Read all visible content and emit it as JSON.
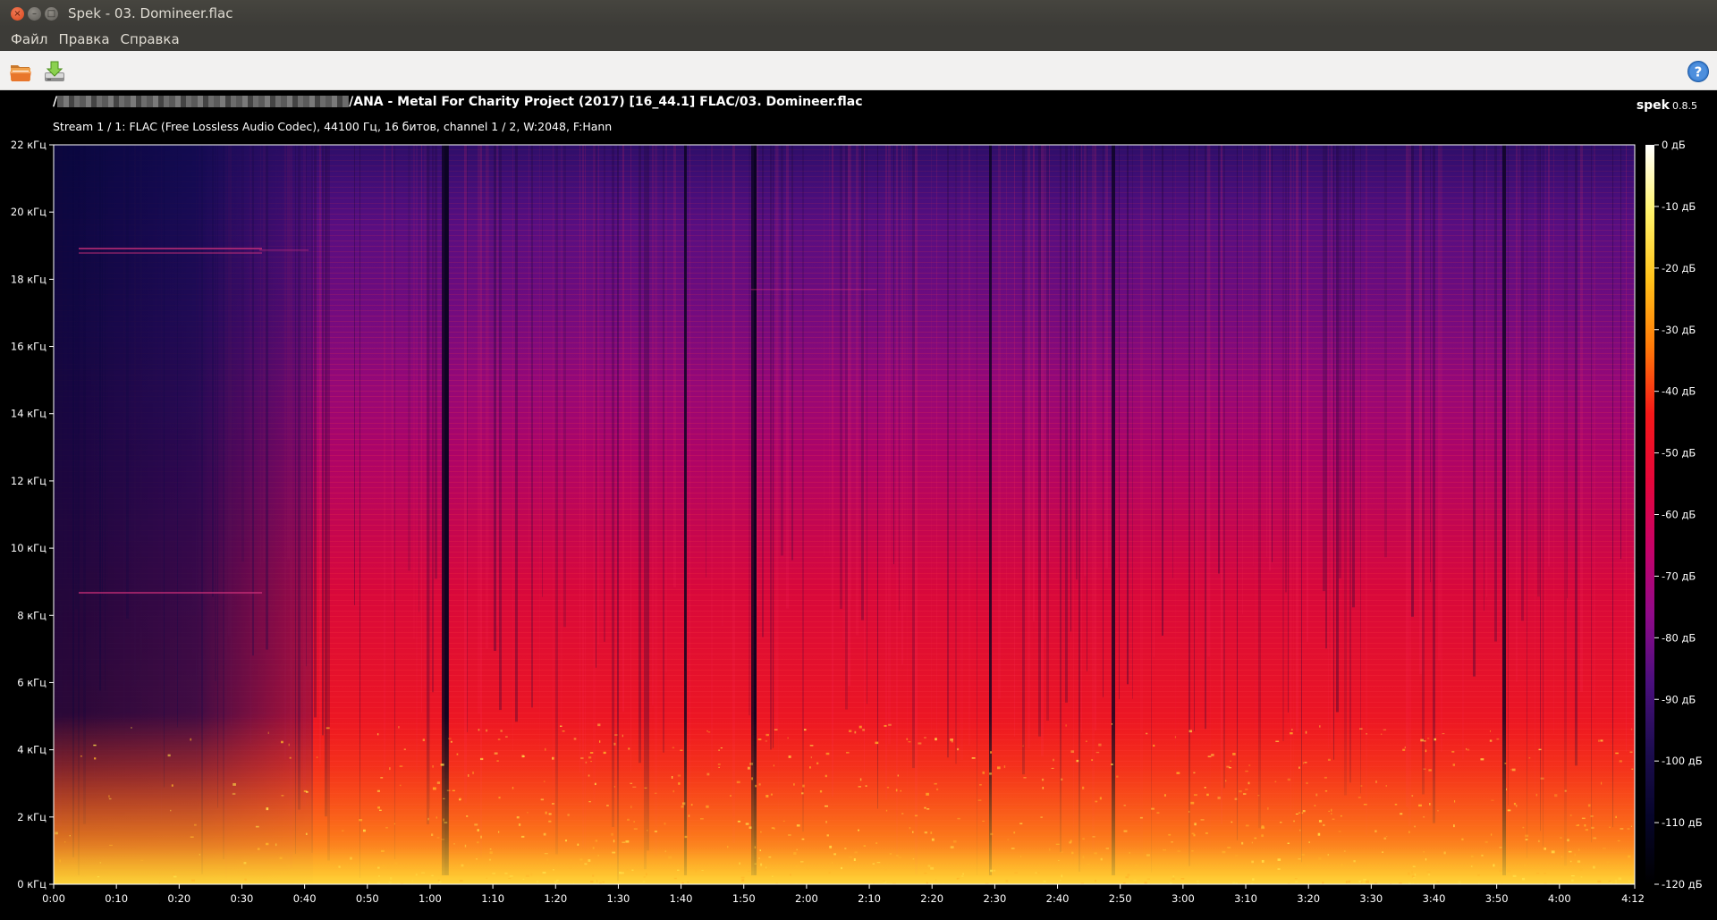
{
  "window": {
    "title": "Spek - 03. Domineer.flac",
    "buttons": {
      "close": "×",
      "minimize": "–",
      "maximize": "□"
    }
  },
  "menu": {
    "items": [
      "Файл",
      "Правка",
      "Справка"
    ]
  },
  "toolbar": {
    "open_icon": "folder-open-icon",
    "save_icon": "save-download-icon",
    "help_icon": "help-icon",
    "help_label": "?",
    "accent": "#2f6fb7"
  },
  "info": {
    "path_prefix": "/",
    "path_suffix": "/ANA - Metal For Charity Project (2017) [16_44.1] FLAC/03. Domineer.flac",
    "stream": "Stream 1 / 1: FLAC (Free Lossless Audio Codec), 44100 Гц, 16 битов, channel 1 / 2, W:2048, F:Hann",
    "brand_name": "spek",
    "brand_version": "0.8.5"
  },
  "spectrogram": {
    "freq_labels": [
      "22 кГц",
      "20 кГц",
      "18 кГц",
      "16 кГц",
      "14 кГц",
      "12 кГц",
      "10 кГц",
      "8 кГц",
      "6 кГц",
      "4 кГц",
      "2 кГц",
      "0 кГц"
    ],
    "time_labels": [
      "0:00",
      "0:10",
      "0:20",
      "0:30",
      "0:40",
      "0:50",
      "1:00",
      "1:10",
      "1:20",
      "1:30",
      "1:40",
      "1:50",
      "2:00",
      "2:10",
      "2:20",
      "2:30",
      "2:40",
      "2:50",
      "3:00",
      "3:10",
      "3:20",
      "3:30",
      "3:40",
      "3:50",
      "4:00"
    ],
    "time_end_label": "4:12",
    "duration_seconds": 252,
    "db_labels": [
      "0 дБ",
      "-10 дБ",
      "-20 дБ",
      "-30 дБ",
      "-40 дБ",
      "-50 дБ",
      "-60 дБ",
      "-70 дБ",
      "-80 дБ",
      "-90 дБ",
      "-100 дБ",
      "-110 дБ",
      "-120 дБ"
    ],
    "palette": [
      "#ffffff",
      "#fff26a",
      "#ffc21a",
      "#ff7a08",
      "#f51818",
      "#e4063a",
      "#c60268",
      "#8f0a8a",
      "#4a0f7d",
      "#1d0d50",
      "#06052a",
      "#000000"
    ]
  }
}
